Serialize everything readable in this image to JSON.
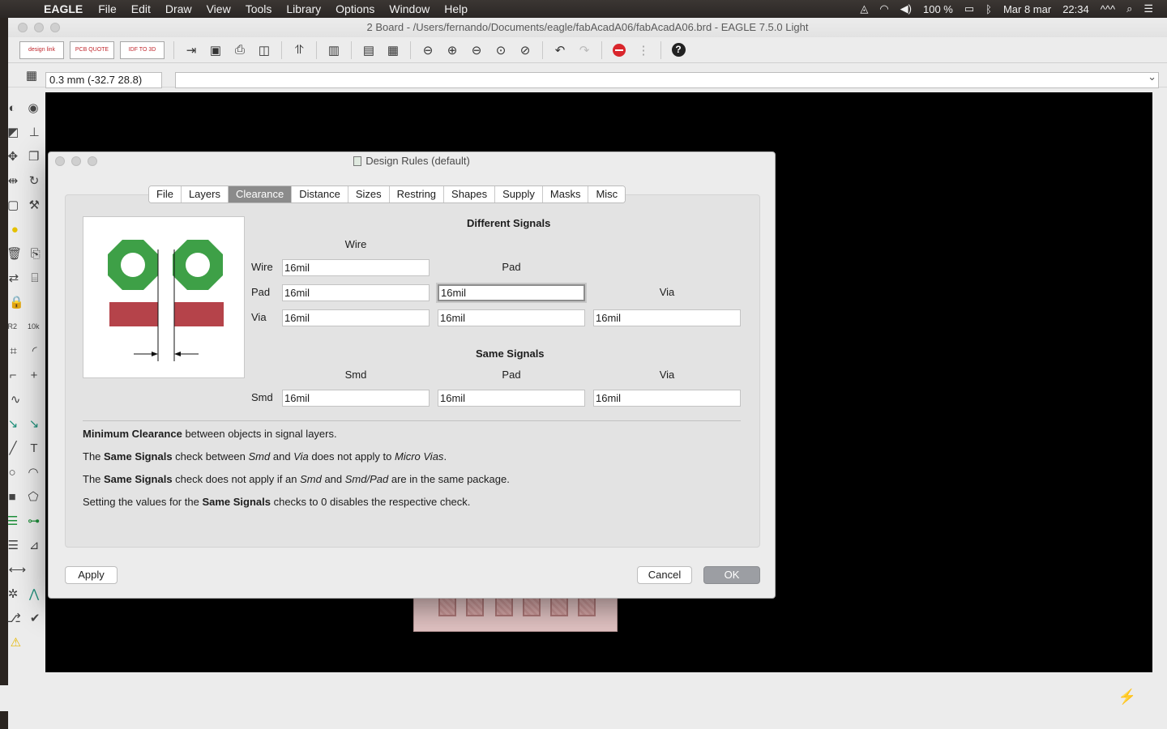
{
  "menubar": {
    "apple": "",
    "app_name": "EAGLE",
    "menus": [
      "File",
      "Edit",
      "Draw",
      "View",
      "Tools",
      "Library",
      "Options",
      "Window",
      "Help"
    ],
    "battery": "100 %",
    "date": "Mar 8 mar",
    "time": "22:34",
    "extra": "^^^"
  },
  "window": {
    "title": "2 Board - /Users/fernando/Documents/eagle/fabAcadA06/fabAcadA06.brd - EAGLE 7.5.0 Light",
    "toolbar_logos": [
      {
        "text": "design link"
      },
      {
        "text": "PCB QUOTE"
      },
      {
        "text": "IDF TO 3D"
      }
    ],
    "coordinate": "0.3 mm (-32.7 28.8)",
    "command": ""
  },
  "dialog": {
    "title": "Design Rules (default)",
    "tabs": [
      {
        "label": "File"
      },
      {
        "label": "Layers"
      },
      {
        "label": "Clearance"
      },
      {
        "label": "Distance"
      },
      {
        "label": "Sizes"
      },
      {
        "label": "Restring"
      },
      {
        "label": "Shapes"
      },
      {
        "label": "Supply"
      },
      {
        "label": "Masks"
      },
      {
        "label": "Misc"
      }
    ],
    "active_tab": "Clearance",
    "different_signals": {
      "heading": "Different Signals",
      "col_wire": "Wire",
      "col_pad": "Pad",
      "col_via": "Via",
      "row_wire": "Wire",
      "row_pad": "Pad",
      "row_via": "Via",
      "wire_wire": "16mil",
      "pad_wire": "16mil",
      "pad_pad": "16mil",
      "via_wire": "16mil",
      "via_pad": "16mil",
      "via_via": "16mil"
    },
    "same_signals": {
      "heading": "Same Signals",
      "col_smd": "Smd",
      "col_pad": "Pad",
      "col_via": "Via",
      "row_smd": "Smd",
      "smd_smd": "16mil",
      "smd_pad": "16mil",
      "smd_via": "16mil"
    },
    "notes": {
      "n1_bold": "Minimum Clearance",
      "n1_rest": " between objects in signal layers.",
      "n2_a": "The ",
      "n2_bold": "Same Signals",
      "n2_b": " check between ",
      "n2_i1": "Smd",
      "n2_c": " and ",
      "n2_i2": "Via",
      "n2_d": " does not apply to ",
      "n2_i3": "Micro Vias",
      "n2_e": ".",
      "n3_a": "The ",
      "n3_bold": "Same Signals",
      "n3_b": " check does not apply if an ",
      "n3_i1": "Smd",
      "n3_c": " and ",
      "n3_i2": "Smd/Pad",
      "n3_d": " are in the same package.",
      "n4_a": "Setting the values for the ",
      "n4_bold": "Same Signals",
      "n4_b": " checks to 0 disables the respective check."
    },
    "buttons": {
      "apply": "Apply",
      "cancel": "Cancel",
      "ok": "OK"
    }
  },
  "colors": {
    "pad_green": "#3ea047",
    "smd_red": "#b5434a",
    "canvas": "#000000",
    "active_tab": "#8b8b8b"
  }
}
